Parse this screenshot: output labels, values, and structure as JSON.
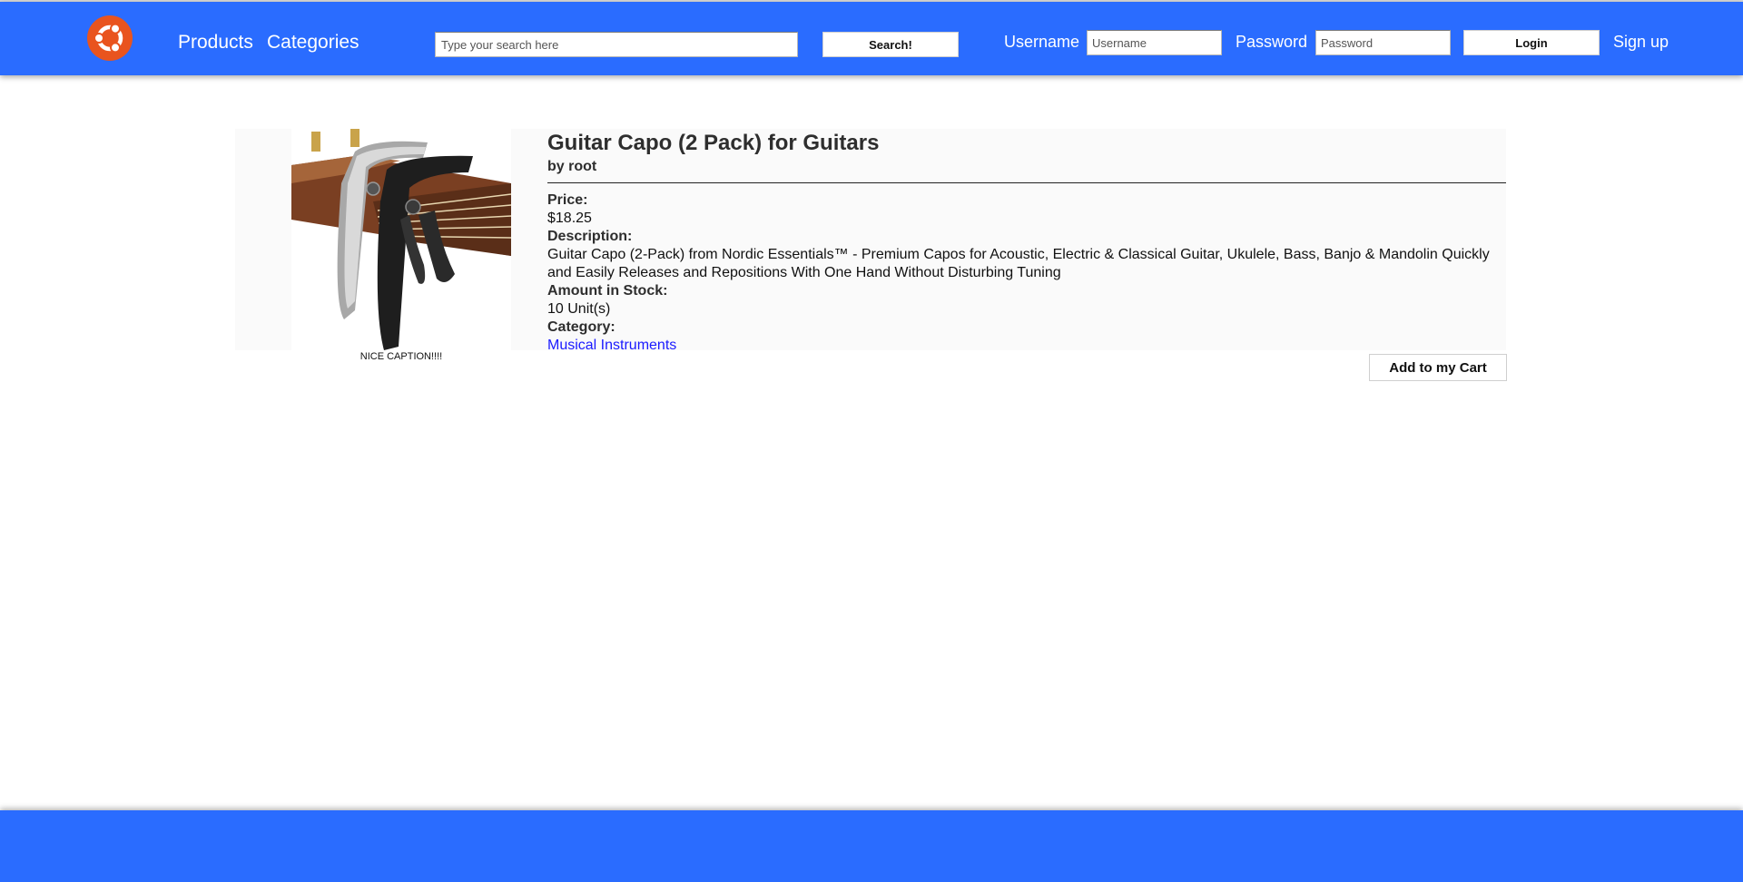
{
  "header": {
    "logo_icon": "ubuntu-logo-icon",
    "nav": {
      "products": "Products",
      "categories": "Categories"
    },
    "search": {
      "placeholder": "Type your search here",
      "value": "",
      "button": "Search!"
    },
    "login": {
      "username_label": "Username",
      "username_placeholder": "Username",
      "password_label": "Password",
      "password_placeholder": "Password",
      "login_button": "Login",
      "signup": "Sign up"
    }
  },
  "product": {
    "title": "Guitar Capo (2 Pack) for Guitars",
    "byline": "by root",
    "image_caption": "NICE CAPTION!!!!",
    "price_label": "Price:",
    "price": "$18.25",
    "description_label": "Description:",
    "description": "Guitar Capo (2-Pack) from Nordic Essentials™ - Premium Capos for Acoustic, Electric & Classical Guitar, Ukulele, Bass, Banjo & Mandolin Quickly and Easily Releases and Repositions With One Hand Without Disturbing Tuning",
    "stock_label": "Amount in Stock:",
    "stock": "10 Unit(s)",
    "category_label": "Category:",
    "category": "Musical Instruments",
    "add_to_cart": "Add to my Cart"
  },
  "colors": {
    "navbar": "#2a6cff",
    "logo": "#e9541e",
    "link": "#1a1aff"
  }
}
